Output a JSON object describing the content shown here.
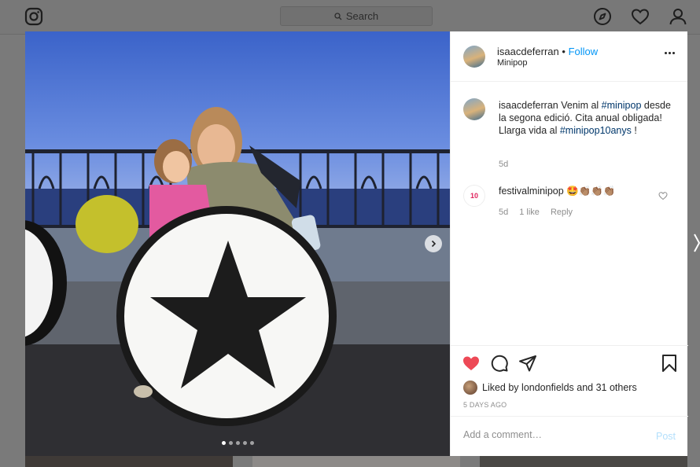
{
  "nav": {
    "search_placeholder": "Search",
    "icons": [
      "instagram-logo-icon",
      "search-icon",
      "explore-compass-icon",
      "heart-icon",
      "profile-icon"
    ]
  },
  "post": {
    "username": "isaacdeferran",
    "separator": "•",
    "follow_label": "Follow",
    "location": "Minipop",
    "caption": {
      "username": "isaacdeferran",
      "text_1": "Venim al",
      "hashtag_1": "#minipop",
      "text_2": "desde la segona edició. Cita anual obligada! Llarga vida al",
      "hashtag_2": "#minipop10anys",
      "text_3": "!",
      "time": "5d"
    },
    "reply": {
      "username": "festivalminipop",
      "text": "🤩👏🏽👏🏽👏🏽",
      "avatar_text": "10",
      "time": "5d",
      "likes": "1 like",
      "reply_label": "Reply"
    },
    "likes_text_prefix": "Liked by",
    "likes_user": "londonfields",
    "likes_and": "and",
    "likes_others": "31 others",
    "time_ago": "5 DAYS AGO",
    "comment_placeholder": "Add a comment…",
    "post_label": "Post",
    "carousel": {
      "total": 5,
      "active": 1
    }
  },
  "colors": {
    "like_red": "#ed4956",
    "link_blue": "#0095f6",
    "hashtag_blue": "#00376b",
    "muted": "#8e8e8e"
  }
}
